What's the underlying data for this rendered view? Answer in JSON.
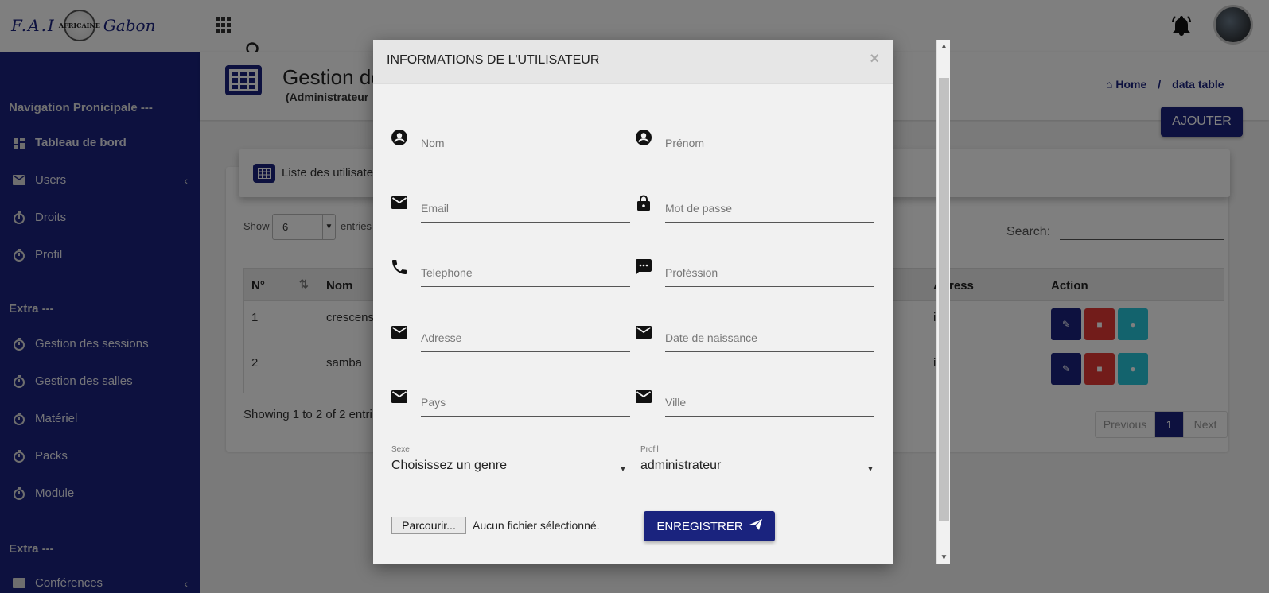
{
  "brand": {
    "left": "F.A.I",
    "badge": "AFRICAINE",
    "right": "Gabon"
  },
  "sidebar": {
    "section_main": "Navigation Pronicipale ---",
    "items": [
      {
        "label": "Tableau de bord",
        "icon": "dashboard-icon"
      },
      {
        "label": "Users",
        "icon": "mail-icon"
      },
      {
        "label": "Droits",
        "icon": "timer-icon"
      },
      {
        "label": "Profil",
        "icon": "timer-icon"
      }
    ],
    "section_extra": "Extra ---",
    "extra_items": [
      {
        "label": "Gestion des sessions",
        "icon": "timer-icon"
      },
      {
        "label": "Gestion des salles",
        "icon": "timer-icon"
      },
      {
        "label": "Matériel",
        "icon": "timer-icon"
      },
      {
        "label": "Packs",
        "icon": "timer-icon"
      },
      {
        "label": "Module",
        "icon": "timer-icon"
      }
    ],
    "section_extra2": "Extra ---",
    "partial_item": "Conférences"
  },
  "header": {
    "title": "Gestion de",
    "subtitle": "(Administrateur",
    "breadcrumb_home": "Home",
    "breadcrumb_sep": "/",
    "breadcrumb_current": "data table",
    "add_button": "AJOUTER"
  },
  "list": {
    "title": "Liste des utilisate",
    "show_label": "Show",
    "show_value": "6",
    "entries_label": "entries",
    "search_label": "Search:",
    "columns": [
      "N°",
      "Nom",
      "Adress",
      "Action"
    ],
    "rows": [
      {
        "n": "1",
        "nom": "crescens",
        "adress": "ia"
      },
      {
        "n": "2",
        "nom": "samba",
        "adress": "ia"
      }
    ],
    "showing": "Showing 1 to 2 of 2 entri",
    "pager": {
      "prev": "Previous",
      "current": "1",
      "next": "Next"
    }
  },
  "modal": {
    "title": "INFORMATIONS DE L'UTILISATEUR",
    "close": "×",
    "fields": [
      {
        "placeholder": "Nom",
        "icon": "account-circle-icon"
      },
      {
        "placeholder": "Prénom",
        "icon": "account-circle-icon"
      },
      {
        "placeholder": "Email",
        "icon": "mail-icon"
      },
      {
        "placeholder": "Mot de passe",
        "icon": "lock-icon"
      },
      {
        "placeholder": "Telephone",
        "icon": "phone-icon"
      },
      {
        "placeholder": "Proféssion",
        "icon": "message-icon"
      },
      {
        "placeholder": "Adresse",
        "icon": "mail-icon"
      },
      {
        "placeholder": "Date de naissance",
        "icon": "mail-icon"
      },
      {
        "placeholder": "Pays",
        "icon": "mail-icon"
      },
      {
        "placeholder": "Ville",
        "icon": "mail-icon"
      }
    ],
    "sexe_label": "Sexe",
    "sexe_value": "Choisissez un genre",
    "profil_label": "Profil",
    "profil_value": "administrateur",
    "file_button": "Parcourir...",
    "file_status": "Aucun fichier sélectionné.",
    "save_button": "ENREGISTRER"
  },
  "colors": {
    "primary": "#1a237e",
    "danger": "#e53935",
    "info": "#26c6da"
  }
}
